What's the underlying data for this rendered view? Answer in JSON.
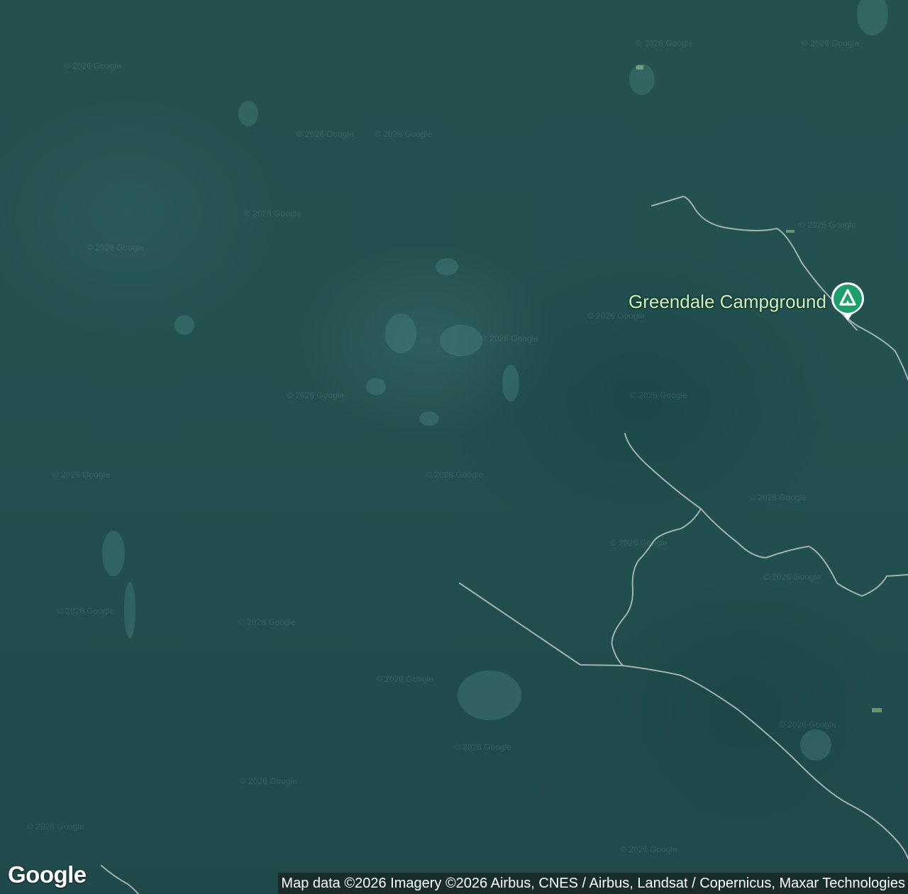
{
  "map": {
    "type": "satellite",
    "watermark_text": "© 2026 Google",
    "road_color": "#b9c4c0",
    "terrain_color": "#22504f"
  },
  "poi": {
    "label": "Greendale Campground",
    "icon": "campground-icon",
    "pin_color": "#1e9e6a",
    "label_color": "#c8f0c8"
  },
  "branding": {
    "logo_text": "Google"
  },
  "attribution": {
    "text": "Map data ©2026 Imagery ©2026 Airbus, CNES / Airbus, Landsat / Copernicus, Maxar Technologies"
  }
}
